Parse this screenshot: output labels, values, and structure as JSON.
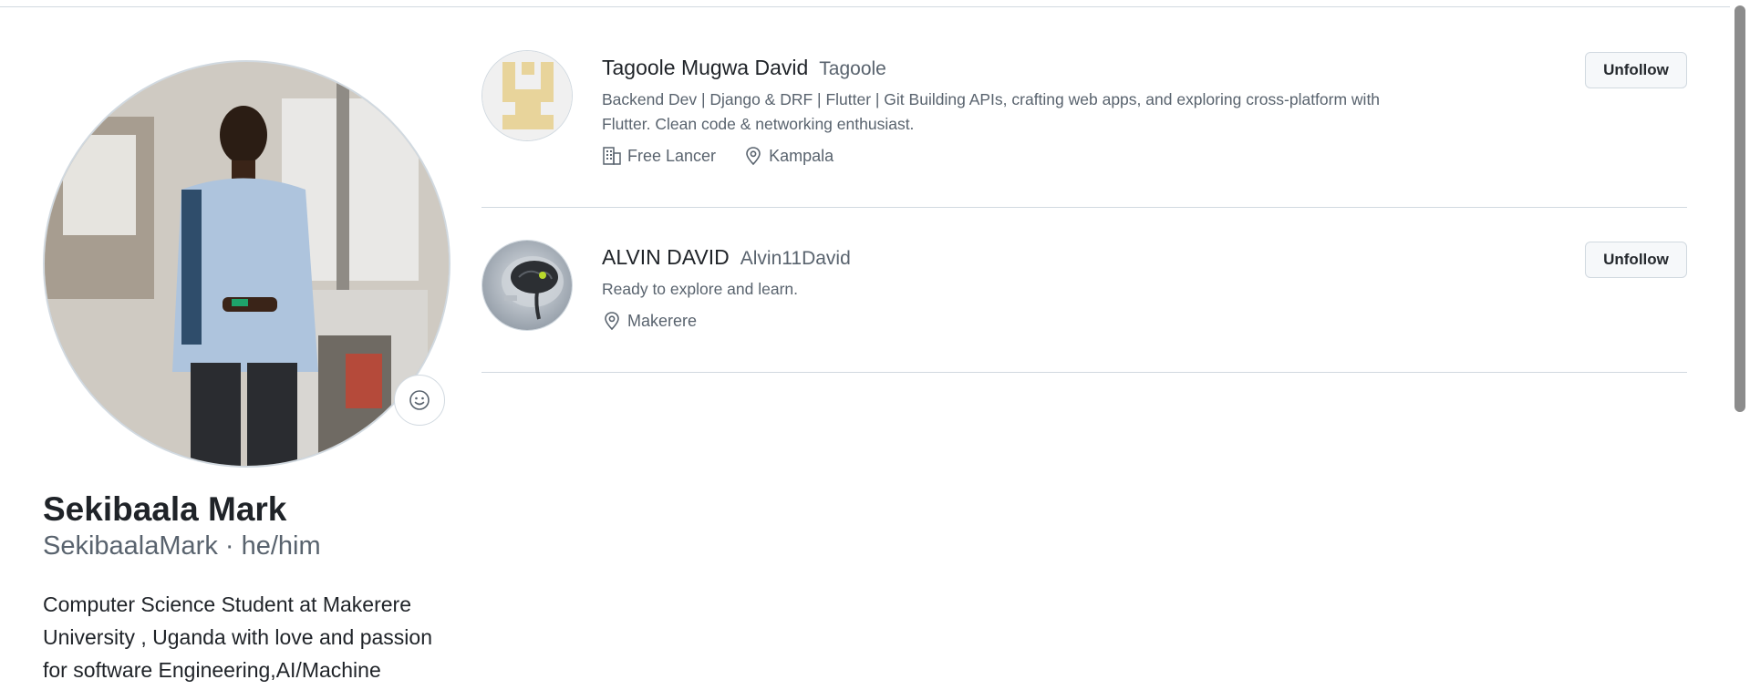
{
  "profile": {
    "name": "Sekibaala Mark",
    "login_line": "SekibaalaMark · he/him",
    "bio": "Computer Science Student at Makerere University , Uganda with love and passion for software Engineering,AI/Machine"
  },
  "following": [
    {
      "name": "Tagoole Mugwa David",
      "login": "Tagoole",
      "bio": "Backend Dev | Django & DRF | Flutter | Git Building APIs, crafting web apps, and exploring cross-platform with Flutter. Clean code & networking enthusiast.",
      "company": "Free Lancer",
      "location": "Kampala",
      "button_label": "Unfollow"
    },
    {
      "name": "ALVIN DAVID",
      "login": "Alvin11David",
      "bio": "Ready to explore and learn.",
      "location": "Makerere",
      "button_label": "Unfollow"
    }
  ],
  "colors": {
    "text_primary": "#1f2328",
    "text_muted": "#59636e",
    "border": "#d1d9e0",
    "identicon": "#e8d49b"
  },
  "icons": {
    "emoji": "smiley-icon",
    "company": "building-icon",
    "location": "location-pin-icon"
  }
}
